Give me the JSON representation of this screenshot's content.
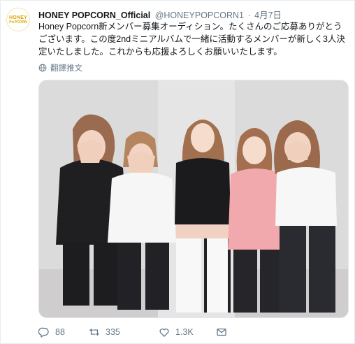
{
  "account": {
    "avatar_logo_top": "HONEY",
    "avatar_logo_bottom": "P❀PCORN",
    "display_name": "HONEY POPCORN_Official",
    "handle": "@HONEYPOPCORN1",
    "separator": "·",
    "date": "4月7日"
  },
  "tweet": {
    "text": "Honey Popcorn新メンバー募集オーディション。たくさんのご応募ありがとうございます。この度2ndミニアルバムで一緒に活動するメンバーが新しく3人決定いたしました。これからも応援よろしくお願いいたします。",
    "translate_label": "翻譯推文"
  },
  "photo": {
    "background_color": "#d9d8d8"
  },
  "actions": {
    "reply_count": "88",
    "retweet_count": "335",
    "like_count": "1.3K"
  },
  "colors": {
    "text": "#14171a",
    "secondary": "#657786",
    "brand": "#e0a400"
  },
  "icons": [
    "globe-icon",
    "reply-icon",
    "retweet-icon",
    "like-icon",
    "message-icon"
  ]
}
